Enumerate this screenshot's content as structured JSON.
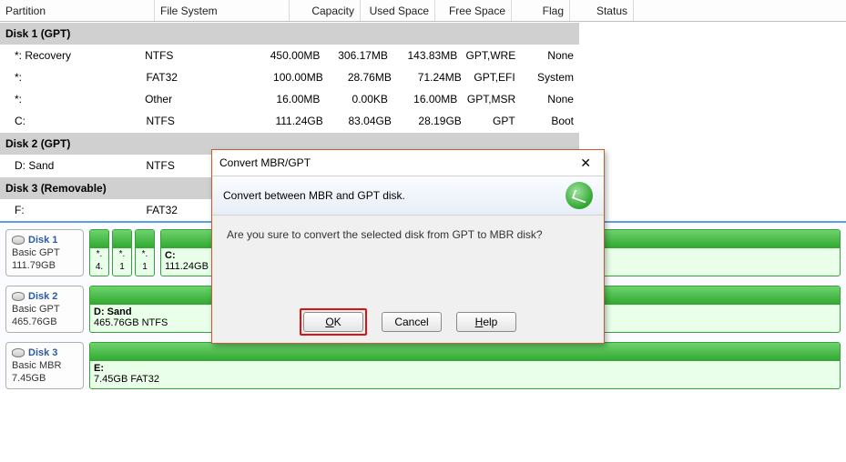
{
  "columns": {
    "partition": "Partition",
    "fs": "File System",
    "capacity": "Capacity",
    "used": "Used Space",
    "free": "Free Space",
    "flag": "Flag",
    "status": "Status"
  },
  "groups": [
    {
      "title": "Disk 1 (GPT)",
      "rows": [
        {
          "part": "*: Recovery",
          "fs": "NTFS",
          "cap": "450.00MB",
          "used": "306.17MB",
          "free": "143.83MB",
          "flag": "GPT,WRE",
          "status": "None"
        },
        {
          "part": "*:",
          "fs": "FAT32",
          "cap": "100.00MB",
          "used": "28.76MB",
          "free": "71.24MB",
          "flag": "GPT,EFI",
          "status": "System"
        },
        {
          "part": "*:",
          "fs": "Other",
          "cap": "16.00MB",
          "used": "0.00KB",
          "free": "16.00MB",
          "flag": "GPT,MSR",
          "status": "None"
        },
        {
          "part": "C:",
          "fs": "NTFS",
          "cap": "111.24GB",
          "used": "83.04GB",
          "free": "28.19GB",
          "flag": "GPT",
          "status": "Boot"
        }
      ]
    },
    {
      "title": "Disk 2 (GPT)",
      "rows": [
        {
          "part": "D: Sand",
          "fs": "NTFS",
          "cap": "",
          "used": "",
          "free": "",
          "flag": "",
          "status": ""
        }
      ]
    },
    {
      "title": "Disk 3 (Removable)",
      "rows": [
        {
          "part": "F:",
          "fs": "FAT32",
          "cap": "",
          "used": "",
          "free": "",
          "flag": "",
          "status": ""
        }
      ]
    }
  ],
  "diskcards": [
    {
      "name": "Disk 1",
      "type": "Basic GPT",
      "size": "111.79GB",
      "mini": [
        {
          "l1": "*.",
          "l2": "4."
        },
        {
          "l1": "*.",
          "l2": "1"
        },
        {
          "l1": "*.",
          "l2": "1"
        }
      ],
      "big": {
        "l1": "C:",
        "l2": "111.24GB NTFS"
      }
    },
    {
      "name": "Disk 2",
      "type": "Basic GPT",
      "size": "465.76GB",
      "vol": {
        "l1": "D: Sand",
        "l2": "465.76GB NTFS"
      }
    },
    {
      "name": "Disk 3",
      "type": "Basic MBR",
      "size": "7.45GB",
      "vol": {
        "l1": "E:",
        "l2": "7.45GB FAT32"
      }
    }
  ],
  "dialog": {
    "title": "Convert MBR/GPT",
    "subtitle": "Convert between MBR and GPT disk.",
    "question": "Are you sure to convert the selected disk from GPT to MBR disk?",
    "ok": "OK",
    "cancel": "Cancel",
    "help": "Help"
  }
}
